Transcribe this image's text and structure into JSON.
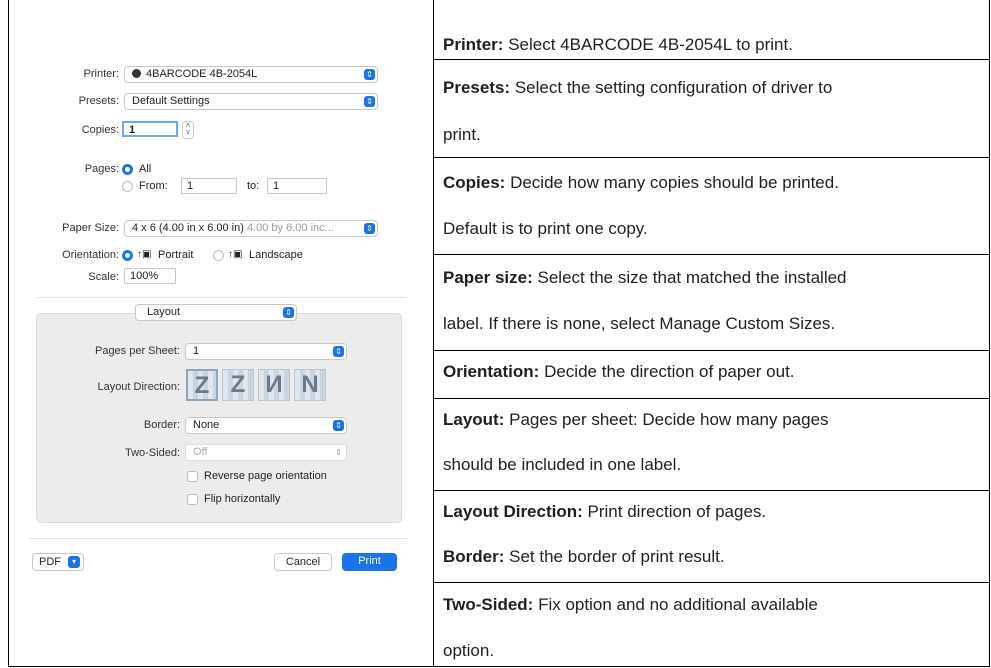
{
  "dialog": {
    "printer_label": "Printer:",
    "printer_value": "4BARCODE 4B-2054L",
    "presets_label": "Presets:",
    "presets_value": "Default Settings",
    "copies_label": "Copies:",
    "copies_value": "1",
    "pages_label": "Pages:",
    "pages_all": "All",
    "pages_from": "From:",
    "pages_from_value": "1",
    "pages_to": "to:",
    "pages_to_value": "1",
    "paper_label": "Paper Size:",
    "paper_value": "4 x 6 (4.00 in x 6.00 in)",
    "paper_dim": "4.00 by 6.00 inc...",
    "orientation_label": "Orientation:",
    "portrait": "Portrait",
    "landscape": "Landscape",
    "scale_label": "Scale:",
    "scale_value": "100%",
    "section_value": "Layout",
    "pps_label": "Pages per Sheet:",
    "pps_value": "1",
    "layout_dir_label": "Layout Direction:",
    "layout_dir_icons": [
      "Z",
      "Z",
      "И",
      "N"
    ],
    "border_label": "Border:",
    "border_value": "None",
    "twosided_label": "Two-Sided:",
    "twosided_value": "Off",
    "reverse_label": "Reverse page orientation",
    "flip_label": "Flip horizontally",
    "pdf_label": "PDF",
    "cancel_label": "Cancel",
    "print_label": "Print"
  },
  "rows": [
    {
      "term": "Printer:",
      "lines": [
        "Select 4BARCODE 4B-2054L to print."
      ]
    },
    {
      "term": "Presets:",
      "lines": [
        "Select the setting configuration of driver to",
        "print."
      ]
    },
    {
      "term": "Copies:",
      "lines": [
        "Decide how many copies should be printed.",
        "Default is to print one copy."
      ]
    },
    {
      "term": "Paper size:",
      "lines": [
        "Select the size that matched the installed",
        "label. If there is none, select Manage Custom Sizes."
      ]
    },
    {
      "term": "Orientation:",
      "lines": [
        "Decide the direction of paper out."
      ]
    },
    {
      "term": "Layout:",
      "lines": [
        "Pages per sheet: Decide how many pages",
        "should be included in one label."
      ]
    },
    {
      "term": "Layout Direction:",
      "lines": [
        "Print direction of pages.",
        ""
      ],
      "term2": "Border:",
      "line2": "Set the border of print result."
    },
    {
      "term": "Two-Sided:",
      "lines": [
        "Fix option and no additional available",
        "option."
      ]
    }
  ],
  "colors": {
    "accent": "#1a73e8",
    "panel": "#ececec"
  }
}
